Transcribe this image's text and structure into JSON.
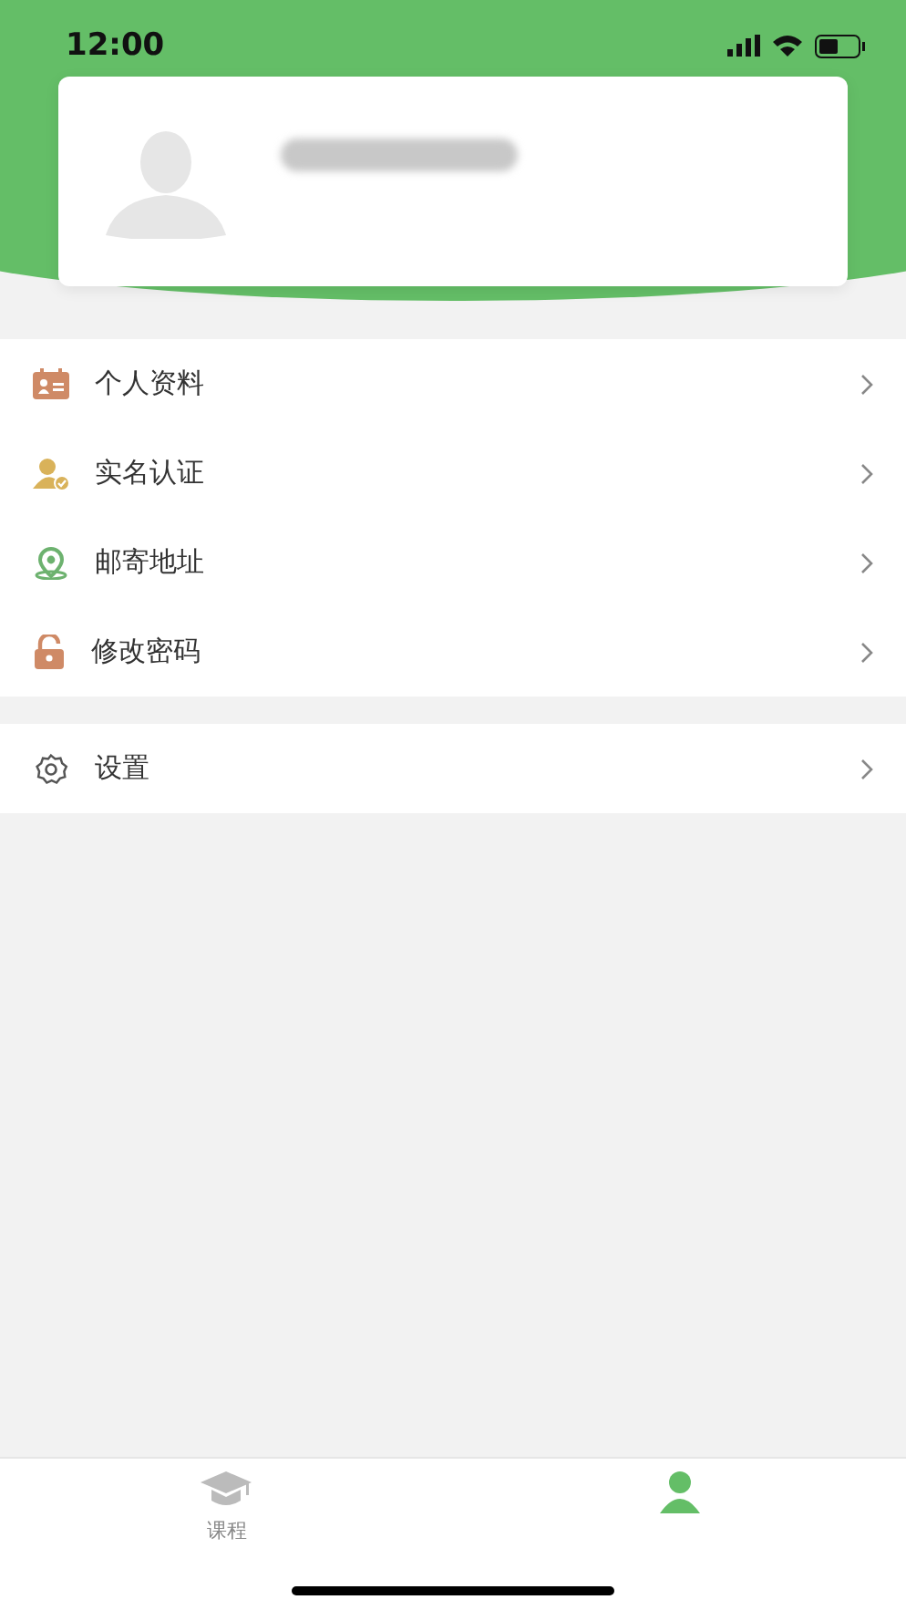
{
  "status_bar": {
    "time": "12:00"
  },
  "menu_groups": [
    {
      "items": [
        {
          "label": "个人资料",
          "kind": "profile"
        },
        {
          "label": "实名认证",
          "kind": "verify"
        },
        {
          "label": "邮寄地址",
          "kind": "address"
        },
        {
          "label": "修改密码",
          "kind": "password"
        }
      ]
    },
    {
      "items": [
        {
          "label": "设置",
          "kind": "settings"
        }
      ]
    }
  ],
  "tab_bar": [
    {
      "label": "课程",
      "kind": "course",
      "selected": false
    },
    {
      "kind": "mine",
      "selected": true
    }
  ]
}
